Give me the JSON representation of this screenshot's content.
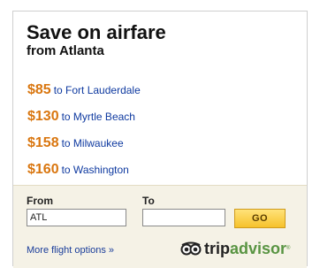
{
  "header": {
    "title": "Save on airfare",
    "subtitle": "from Atlanta"
  },
  "deals": [
    {
      "price": "$85",
      "destination": "to Fort Lauderdale"
    },
    {
      "price": "$130",
      "destination": "to Myrtle Beach"
    },
    {
      "price": "$158",
      "destination": "to Milwaukee"
    },
    {
      "price": "$160",
      "destination": "to Washington"
    }
  ],
  "search": {
    "from_label": "From",
    "to_label": "To",
    "from_value": "ATL",
    "to_value": "",
    "go_label": "GO"
  },
  "footer": {
    "more_link": "More flight options »",
    "logo_trip": "trip",
    "logo_advisor": "advisor",
    "logo_reg": "®"
  },
  "colors": {
    "price": "#d9760f",
    "link": "#0f3aa0",
    "footer_bg": "#f5f2e6",
    "go_button": "#f6c22b",
    "brand_green": "#589442"
  },
  "icons": {
    "logo": "tripadvisor-owl-eyes-icon"
  }
}
